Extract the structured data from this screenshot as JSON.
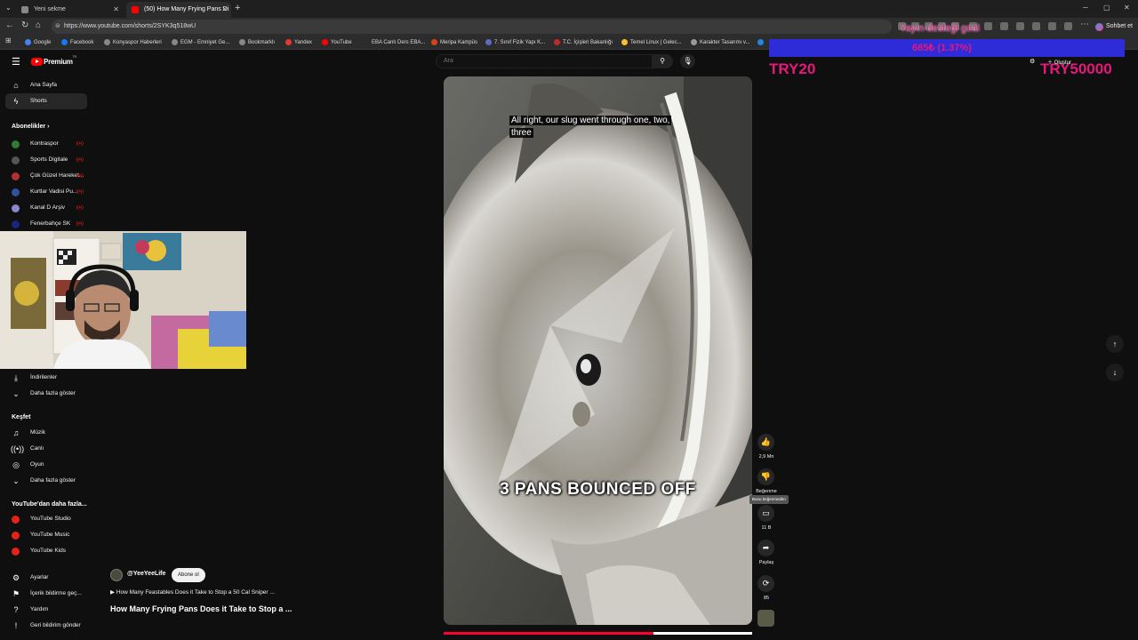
{
  "browser": {
    "tabs": [
      {
        "label": "Yeni sekme",
        "active": false
      },
      {
        "label": "(50) How Many Frying Pans Di",
        "active": true
      }
    ],
    "url": "https://www.youtube.com/shorts/2SYK3q518wU",
    "chat_button": "Sohbet et",
    "bookmarks": [
      "Google",
      "Facebook",
      "Konyaspor Haberleri",
      "EGM - Emniyet Ge...",
      "Bookmarklı",
      "Yandex",
      "YouTube",
      "EBA Canlı Ders EBA...",
      "Meripa Kampüs",
      "7. Sınıf Fizik Yapı K...",
      "T.C. İçişleri Bakanlığı",
      "Temel Linux | Gelec...",
      "Karakter Tasarımı v..."
    ]
  },
  "header": {
    "logo_text": "Premium",
    "logo_region": "TR",
    "search_placeholder": "Ara"
  },
  "sidebar": {
    "main": [
      {
        "label": "Ana Sayfa",
        "icon": "home-icon"
      },
      {
        "label": "Shorts",
        "icon": "shorts-icon"
      }
    ],
    "subscriptions_heading": "Abonelikler",
    "subscriptions": [
      {
        "label": "Kontraspor",
        "color": "#2e7d32"
      },
      {
        "label": "Sports Digitale",
        "color": "#222222"
      },
      {
        "label": "Çok Güzel Hareket...",
        "color": "#b03030"
      },
      {
        "label": "Kurtlar Vadisi Pu...",
        "color": "#3050a0"
      },
      {
        "label": "Kanal D Arşiv",
        "color": "#8888cc"
      },
      {
        "label": "Fenerbahçe SK",
        "color": "#1a237e"
      }
    ],
    "you": [
      {
        "label": "İndirilenler",
        "icon": "download-icon"
      },
      {
        "label": "Daha fazla göster",
        "icon": "chevron-down-icon"
      }
    ],
    "explore_heading": "Keşfet",
    "explore": [
      {
        "label": "Müzik",
        "icon": "music-icon"
      },
      {
        "label": "Canlı",
        "icon": "live-icon"
      },
      {
        "label": "Oyun",
        "icon": "gaming-icon"
      },
      {
        "label": "Daha fazla göster",
        "icon": "chevron-down-icon"
      }
    ],
    "more_heading": "YouTube'dan daha fazla...",
    "more": [
      "YouTube Studio",
      "YouTube Music",
      "YouTube Kids"
    ],
    "footer": [
      {
        "label": "Ayarlar",
        "icon": "gear-icon"
      },
      {
        "label": "İçerik bildirme geç...",
        "icon": "flag-icon"
      },
      {
        "label": "Yardım",
        "icon": "help-icon"
      },
      {
        "label": "Geri bildirim gönder",
        "icon": "feedback-icon"
      }
    ]
  },
  "video": {
    "caption_top": "All right, our slug went through one, two, three",
    "caption_big": "3 PANS BOUNCED OFF",
    "progress": 0.68
  },
  "actions": {
    "likes": "2,9 Mn",
    "dislike_label": "Beğenme",
    "dislike_tooltip": "Bunu beğenmedim",
    "comments": "11 B",
    "share": "Paylaş",
    "remix": "85"
  },
  "channel": {
    "name": "@YeeYeeLife",
    "subscribe": "Abone ol",
    "related": "How Many Feastables Does it Take to Stop a 50 Cal Sniper ...",
    "title": "How Many Frying Pans Does it Take to Stop a ..."
  },
  "overlay": {
    "goal_title": "Yayın desteği goal",
    "goal_amount": "685₺ (1.37%)",
    "goal_min": "TRY20",
    "goal_max": "TRY50000",
    "bar_color": "#2e2bd8",
    "text_color": "#e5187c"
  }
}
